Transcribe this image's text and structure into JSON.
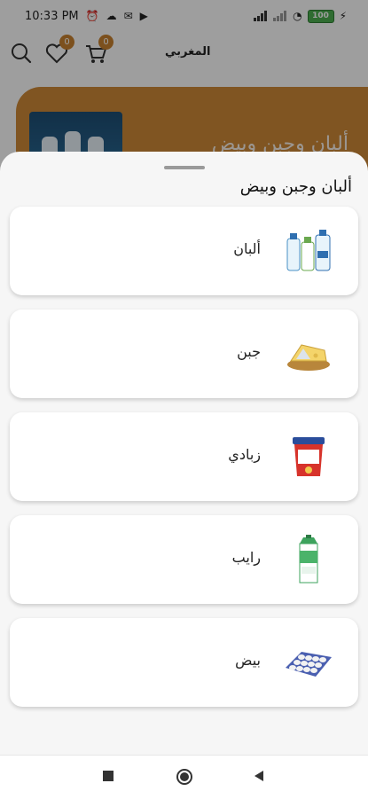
{
  "status_bar": {
    "time": "10:33 PM",
    "battery": "100"
  },
  "header": {
    "store_name": "المغربي",
    "wishlist_count": "0",
    "cart_count": "0"
  },
  "banner": {
    "title": "ألبان وجبن وبيض"
  },
  "sheet": {
    "title": "ألبان وجبن وبيض",
    "categories": [
      {
        "label": "ألبان",
        "icon": "milk-bottles-icon"
      },
      {
        "label": "جبن",
        "icon": "cheese-icon"
      },
      {
        "label": "زبادي",
        "icon": "yogurt-cup-icon"
      },
      {
        "label": "رايب",
        "icon": "rayeb-carton-icon"
      },
      {
        "label": "بيض",
        "icon": "egg-tray-icon"
      }
    ]
  },
  "colors": {
    "accent": "#cf8a38",
    "badge": "#c9822f",
    "battery": "#4caf50"
  }
}
